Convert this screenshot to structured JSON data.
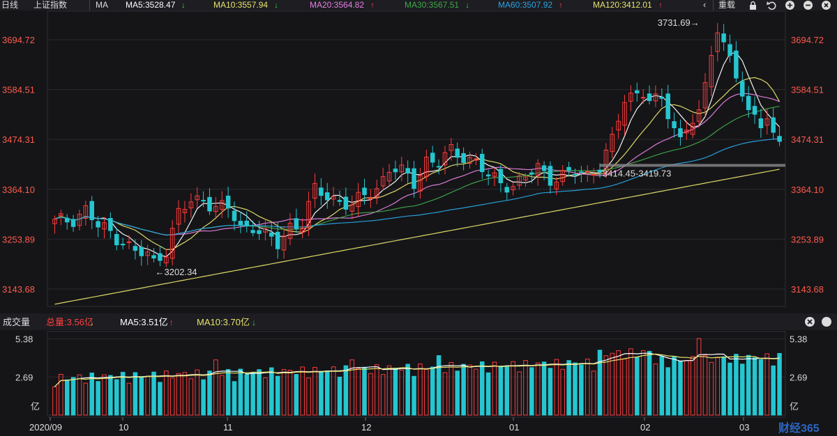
{
  "toolbar": {
    "period_label": "日线",
    "index_label": "上证指数",
    "indicator_label": "MA",
    "ma_readouts": [
      {
        "label": "MA5:3528.47",
        "arrow": "down",
        "color": "#ffffff"
      },
      {
        "label": "MA10:3557.94",
        "arrow": "down",
        "color": "#e8e36b"
      },
      {
        "label": "MA20:3564.82",
        "arrow": "up",
        "color": "#e67fe0"
      },
      {
        "label": "MA30:3567.51",
        "arrow": "down",
        "color": "#3fa648"
      },
      {
        "label": "MA60:3507.92",
        "arrow": "up",
        "color": "#2aa3e0"
      },
      {
        "label": "MA120:3412.01",
        "arrow": "up",
        "color": "#e8e36b"
      }
    ],
    "back_label": "‹",
    "reload_label": "重载",
    "icons": [
      "lock-icon",
      "undo-icon",
      "zoom-in-icon",
      "zoom-out-icon"
    ]
  },
  "volume_header": {
    "title": "成交量",
    "total": {
      "label": "总量:3.56亿",
      "arrow": "down",
      "color": "#ff4040"
    },
    "ma5": {
      "label": "MA5:3.51亿",
      "arrow": "up",
      "color": "#ffffff"
    },
    "ma10": {
      "label": "MA10:3.70亿",
      "arrow": "down",
      "color": "#e8e36b"
    }
  },
  "colors": {
    "up": "#ff3b3b",
    "down": "#25c6d0",
    "grid": "#2b2b30",
    "axis_text_price": "#ff5a4a",
    "axis_text_vol": "#d8d8d8",
    "bg": "#151518"
  },
  "chart_data": [
    {
      "type": "candlestick",
      "name": "上证指数 日线",
      "y_ticks": [
        3143.68,
        3253.89,
        3364.1,
        3474.31,
        3584.51,
        3694.72
      ],
      "y_tick_labels": [
        "3143.68",
        "3253.89",
        "3364.10",
        "3474.31",
        "3584.51",
        "3694.72"
      ],
      "ylim": [
        3105,
        3758
      ],
      "x_labels": [
        "2020/09",
        "10",
        "11",
        "12",
        "01",
        "02",
        "03"
      ],
      "annotations": [
        {
          "text": "3731.69→",
          "value": 3731.69
        },
        {
          "text": "←3202.34",
          "value": 3202.34
        },
        {
          "text": "3414.45-3419.73",
          "value": 3417
        }
      ],
      "series": [
        {
          "name": "MA5",
          "color": "#ffffff"
        },
        {
          "name": "MA10",
          "color": "#e8e36b"
        },
        {
          "name": "MA20",
          "color": "#e67fe0"
        },
        {
          "name": "MA30",
          "color": "#3fa648"
        },
        {
          "name": "MA60",
          "color": "#2aa3e0"
        },
        {
          "name": "MA120",
          "color": "#e8e36b"
        }
      ],
      "grid": true
    },
    {
      "type": "bar",
      "name": "成交量",
      "y_ticks": [
        2.69,
        5.38
      ],
      "y_tick_labels": [
        "2.69",
        "5.38"
      ],
      "unit_label": "亿",
      "ylim": [
        0,
        5.9
      ],
      "series": [
        {
          "name": "MA5",
          "color": "#ffffff"
        },
        {
          "name": "MA10",
          "color": "#e8e36b"
        }
      ]
    }
  ]
}
